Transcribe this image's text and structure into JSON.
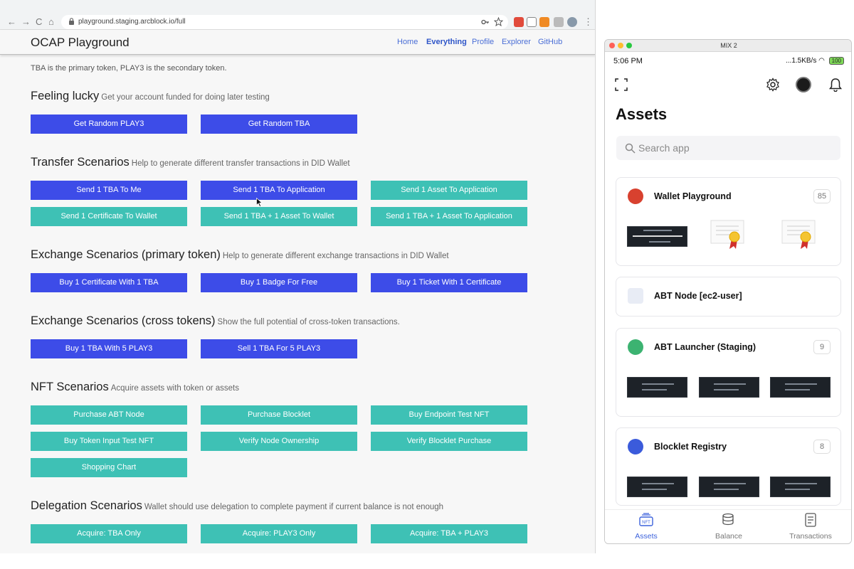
{
  "browser": {
    "url": "playground.staging.arcblock.io/full",
    "nav": {
      "back": "←",
      "forward": "→",
      "reload": "C",
      "home": "⌂"
    }
  },
  "app": {
    "title": "OCAP Playground",
    "nav": [
      {
        "label": "Home",
        "active": false
      },
      {
        "label": "Everything",
        "active": true
      },
      {
        "label": "Profile",
        "active": false
      },
      {
        "label": "Explorer",
        "active": false
      },
      {
        "label": "GitHub",
        "active": false
      }
    ],
    "intro": "TBA is the primary token, PLAY3 is the secondary token."
  },
  "sections": [
    {
      "title": "Feeling lucky",
      "desc": "Get your account funded for doing later testing",
      "buttons": [
        {
          "label": "Get Random PLAY3",
          "color": "blue"
        },
        {
          "label": "Get Random TBA",
          "color": "blue"
        }
      ]
    },
    {
      "title": "Transfer Scenarios",
      "desc": "Help to generate different transfer transactions in DID Wallet",
      "buttons": [
        {
          "label": "Send 1 TBA To Me",
          "color": "blue"
        },
        {
          "label": "Send 1 TBA To Application",
          "color": "blue"
        },
        {
          "label": "Send 1 Asset To Application",
          "color": "teal"
        },
        {
          "label": "Send 1 Certificate To Wallet",
          "color": "teal"
        },
        {
          "label": "Send 1 TBA + 1 Asset To Wallet",
          "color": "teal"
        },
        {
          "label": "Send 1 TBA + 1 Asset To Application",
          "color": "teal"
        }
      ]
    },
    {
      "title": "Exchange Scenarios (primary token)",
      "desc": "Help to generate different exchange transactions in DID Wallet",
      "buttons": [
        {
          "label": "Buy 1 Certificate With 1 TBA",
          "color": "blue"
        },
        {
          "label": "Buy 1 Badge For Free",
          "color": "blue"
        },
        {
          "label": "Buy 1 Ticket With 1 Certificate",
          "color": "blue"
        }
      ]
    },
    {
      "title": "Exchange Scenarios (cross tokens)",
      "desc": "Show the full potential of cross-token transactions.",
      "buttons": [
        {
          "label": "Buy 1 TBA With 5 PLAY3",
          "color": "blue"
        },
        {
          "label": "Sell 1 TBA For 5 PLAY3",
          "color": "blue"
        }
      ]
    },
    {
      "title": "NFT Scenarios",
      "desc": "Acquire assets with token or assets",
      "buttons": [
        {
          "label": "Purchase ABT Node",
          "color": "teal"
        },
        {
          "label": "Purchase Blocklet",
          "color": "teal"
        },
        {
          "label": "Buy Endpoint Test NFT",
          "color": "teal"
        },
        {
          "label": "Buy Token Input Test NFT",
          "color": "teal"
        },
        {
          "label": "Verify Node Ownership",
          "color": "teal"
        },
        {
          "label": "Verify Blocklet Purchase",
          "color": "teal"
        },
        {
          "label": "Shopping Chart",
          "color": "teal"
        }
      ]
    },
    {
      "title": "Delegation Scenarios",
      "desc": "Wallet should use delegation to complete payment if current balance is not enough",
      "buttons": [
        {
          "label": "Acquire: TBA Only",
          "color": "teal"
        },
        {
          "label": "Acquire: PLAY3 Only",
          "color": "teal"
        },
        {
          "label": "Acquire: TBA + PLAY3",
          "color": "teal"
        }
      ]
    }
  ],
  "colors": {
    "blue_button": "#3d4ce8",
    "teal_button": "#3ec1b5",
    "link": "#4a6ed6",
    "tab_active": "#3c62dc"
  },
  "phone": {
    "window_title": "MIX 2",
    "time": "5:06 PM",
    "network": "...1.5KB/s",
    "battery": "100",
    "title": "Assets",
    "search_placeholder": "Search app",
    "cards": [
      {
        "name": "Wallet Playground",
        "count": "85",
        "icon": "maple-leaf-icon"
      },
      {
        "name": "ABT Node [ec2-user]",
        "count": "",
        "icon": "node-icon"
      },
      {
        "name": "ABT Launcher (Staging)",
        "count": "9",
        "icon": "launcher-icon"
      },
      {
        "name": "Blocklet Registry",
        "count": "8",
        "icon": "registry-icon"
      }
    ],
    "tabs": [
      {
        "label": "Assets",
        "active": true,
        "icon": "nft-icon"
      },
      {
        "label": "Balance",
        "active": false,
        "icon": "coins-icon"
      },
      {
        "label": "Transactions",
        "active": false,
        "icon": "document-icon"
      }
    ]
  }
}
